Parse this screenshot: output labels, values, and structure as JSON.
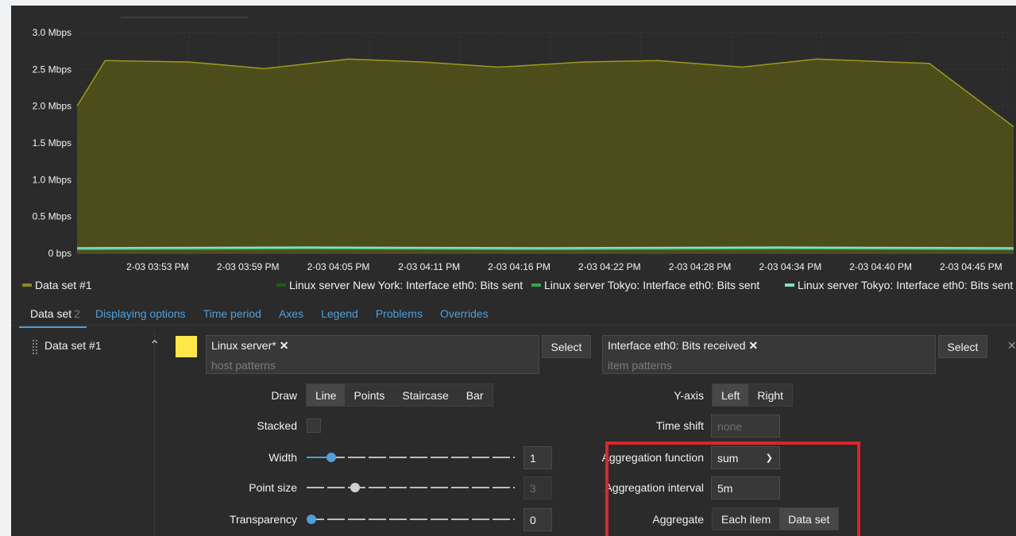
{
  "chart_data": {
    "type": "area",
    "y_ticks": [
      "3.0 Mbps",
      "2.5 Mbps",
      "2.0 Mbps",
      "1.5 Mbps",
      "1.0 Mbps",
      "0.5 Mbps",
      "0 bps"
    ],
    "ylim": [
      0,
      3.0
    ],
    "x_ticks": [
      "2-03 03:53 PM",
      "2-03 03:59 PM",
      "2-03 04:05 PM",
      "2-03 04:11 PM",
      "2-03 04:16 PM",
      "2-03 04:22 PM",
      "2-03 04:28 PM",
      "2-03 04:34 PM",
      "2-03 04:40 PM",
      "2-03 04:45 PM"
    ],
    "grid": true,
    "series": [
      {
        "name": "Data set #1",
        "color": "#8a8a1a",
        "x": [
          0,
          0.03,
          0.12,
          0.2,
          0.29,
          0.37,
          0.45,
          0.54,
          0.62,
          0.71,
          0.79,
          0.87,
          0.91,
          1.0
        ],
        "values": [
          2.0,
          2.62,
          2.6,
          2.51,
          2.64,
          2.6,
          2.53,
          2.6,
          2.62,
          2.53,
          2.64,
          2.6,
          2.58,
          1.72
        ]
      },
      {
        "name": "Linux server New York: Interface eth0: Bits sent",
        "color": "#1e5c1e",
        "x": [
          0,
          0.25,
          0.5,
          0.75,
          1.0
        ],
        "values": [
          0.06,
          0.07,
          0.06,
          0.07,
          0.06
        ]
      },
      {
        "name": "Linux server Tokyo: Interface eth0: Bits sent",
        "color": "#2fa84f",
        "x": [
          0,
          0.25,
          0.5,
          0.75,
          1.0
        ],
        "values": [
          0.05,
          0.06,
          0.05,
          0.06,
          0.05
        ]
      },
      {
        "name": "Linux server Tokyo: Interface eth0: Bits sent",
        "color": "#7fe0c8",
        "x": [
          0,
          0.25,
          0.5,
          0.75,
          1.0
        ],
        "values": [
          0.07,
          0.08,
          0.07,
          0.08,
          0.07
        ]
      }
    ]
  },
  "tabs": [
    {
      "label": "Data set",
      "count": "2"
    },
    {
      "label": "Displaying options"
    },
    {
      "label": "Time period"
    },
    {
      "label": "Axes"
    },
    {
      "label": "Legend"
    },
    {
      "label": "Problems"
    },
    {
      "label": "Overrides"
    }
  ],
  "dataset": {
    "name": "Data set #1",
    "color": "#ffe74c",
    "host_chip": "Linux server*",
    "host_placeholder": "host patterns",
    "item_chip": "Interface eth0: Bits received",
    "item_placeholder": "item patterns",
    "select_label": "Select",
    "remove_icon": "✕"
  },
  "form": {
    "draw_label": "Draw",
    "draw_options": [
      "Line",
      "Points",
      "Staircase",
      "Bar"
    ],
    "draw_selected": "Line",
    "stacked_label": "Stacked",
    "width_label": "Width",
    "width_value": "1",
    "width_level": 0.1,
    "point_size_label": "Point size",
    "point_size_value": "3",
    "point_size_level": 0.22,
    "transparency_label": "Transparency",
    "transparency_value": "0",
    "transparency_level": 0,
    "yaxis_label": "Y-axis",
    "yaxis_options": [
      "Left",
      "Right"
    ],
    "yaxis_selected": "Left",
    "timeshift_label": "Time shift",
    "timeshift_placeholder": "none",
    "agg_func_label": "Aggregation function",
    "agg_func_value": "sum",
    "agg_interval_label": "Aggregation interval",
    "agg_interval_value": "5m",
    "aggregate_label": "Aggregate",
    "aggregate_options": [
      "Each item",
      "Data set"
    ],
    "aggregate_selected": "Data set"
  },
  "colors": {
    "accent": "#4f9fdb",
    "highlight": "#d9262c",
    "background": "#2b2b2b"
  }
}
